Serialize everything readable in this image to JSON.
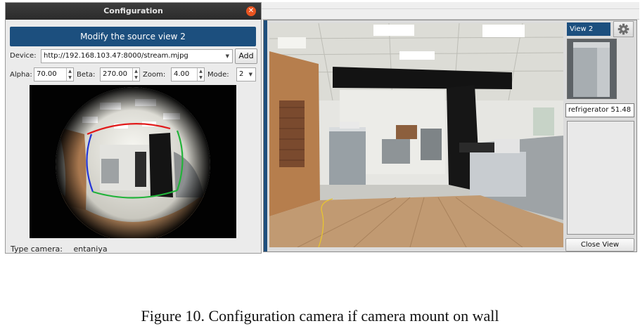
{
  "dialog": {
    "title": "Configuration",
    "banner": "Modify the source view 2",
    "device_label": "Device:",
    "device_value": "http://192.168.103.47:8000/stream.mjpg",
    "add_button": "Add",
    "alpha_label": "Alpha:",
    "alpha_value": "70.00",
    "beta_label": "Beta:",
    "beta_value": "270.00",
    "zoom_label": "Zoom:",
    "zoom_value": "4.00",
    "mode_label": "Mode:",
    "mode_value": "2",
    "type_label": "Type camera:",
    "type_value": "entaniya"
  },
  "main": {
    "view_tab": "View 2",
    "detection_label": "refrigerator 51.48",
    "close_button": "Close View"
  },
  "icons": {
    "close": "close-icon",
    "gear": "gear-icon",
    "dropdown": "chevron-down-icon",
    "spinner": "spin-arrows-icon"
  },
  "colors": {
    "banner": "#1c4f7e",
    "close_button": "#e95420",
    "roi_red": "#e11a1a",
    "roi_green": "#22b33a",
    "roi_blue": "#2436d6"
  },
  "caption": "Figure 10. Configuration camera if camera mount on wall"
}
